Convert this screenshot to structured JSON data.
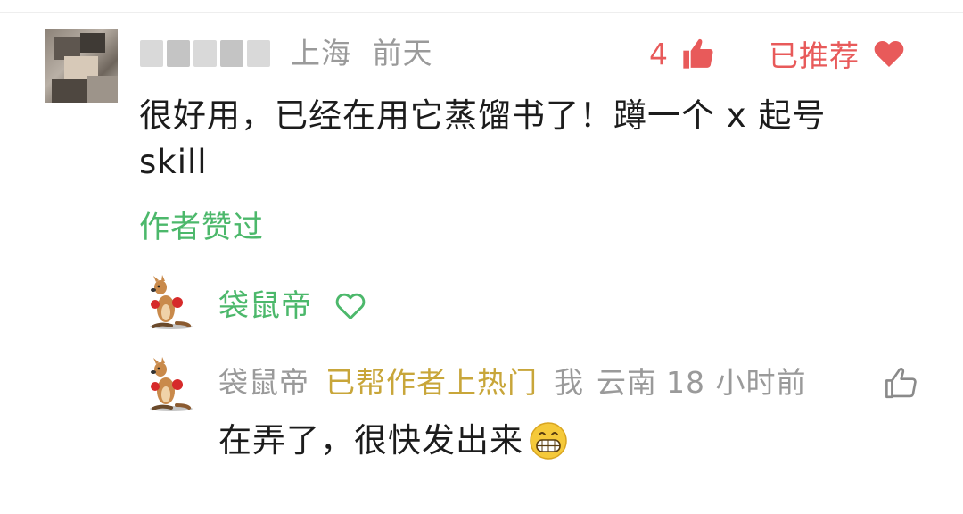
{
  "comment": {
    "location": "上海",
    "time": "前天",
    "like_count": "4",
    "recommend_label": "已推荐",
    "text": "很好用，已经在用它蒸馏书了！蹲一个 x 起号 skill",
    "author_liked_label": "作者赞过"
  },
  "author_reply_header": {
    "name": "袋鼠帝"
  },
  "reply": {
    "name": "袋鼠帝",
    "badge": "已帮作者上热门",
    "me_label": "我",
    "location": "云南",
    "time": "18 小时前",
    "text": "在弄了，很快发出来"
  },
  "colors": {
    "red": "#e85a5a",
    "green": "#4cb86b",
    "gold": "#c8a63a",
    "gray": "#9a9a9a",
    "text": "#1c1c1c"
  },
  "icons": {
    "like": "thumbs-up-icon",
    "recommend": "heart-filled-icon",
    "author_heart": "heart-outline-icon",
    "reply_like": "thumbs-up-outline-icon",
    "emoji": "grinning-face-icon"
  }
}
